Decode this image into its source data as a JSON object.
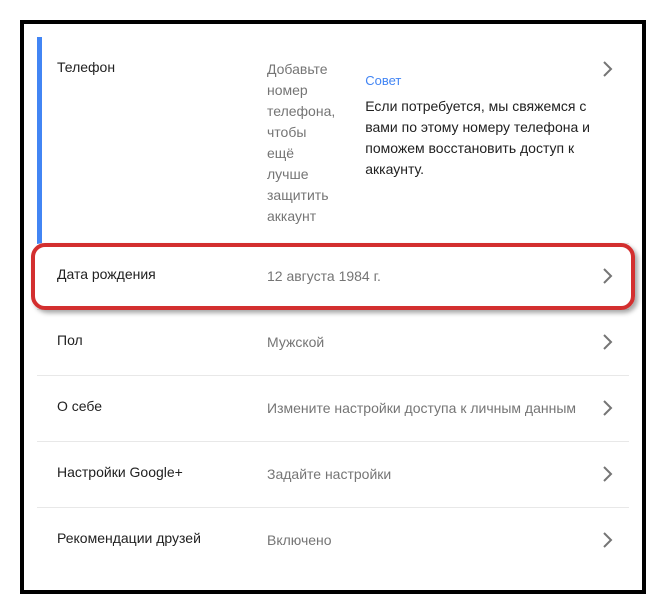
{
  "items": {
    "phone": {
      "label": "Телефон",
      "value": "Добавьте номер телефона, чтобы ещё лучше защитить аккаунт",
      "tip_label": "Совет",
      "tip_text": "Если потребуется, мы свяжемся с вами по этому номеру телефона и поможем восстановить доступ к аккаунту."
    },
    "birthdate": {
      "label": "Дата рождения",
      "value": "12 августа 1984 г."
    },
    "gender": {
      "label": "Пол",
      "value": "Мужской"
    },
    "about": {
      "label": "О себе",
      "value": "Измените настройки доступа к личным данным"
    },
    "googleplus": {
      "label": "Настройки Google+",
      "value": "Задайте настройки"
    },
    "recommendations": {
      "label": "Рекомендации друзей",
      "value": "Включено"
    }
  }
}
